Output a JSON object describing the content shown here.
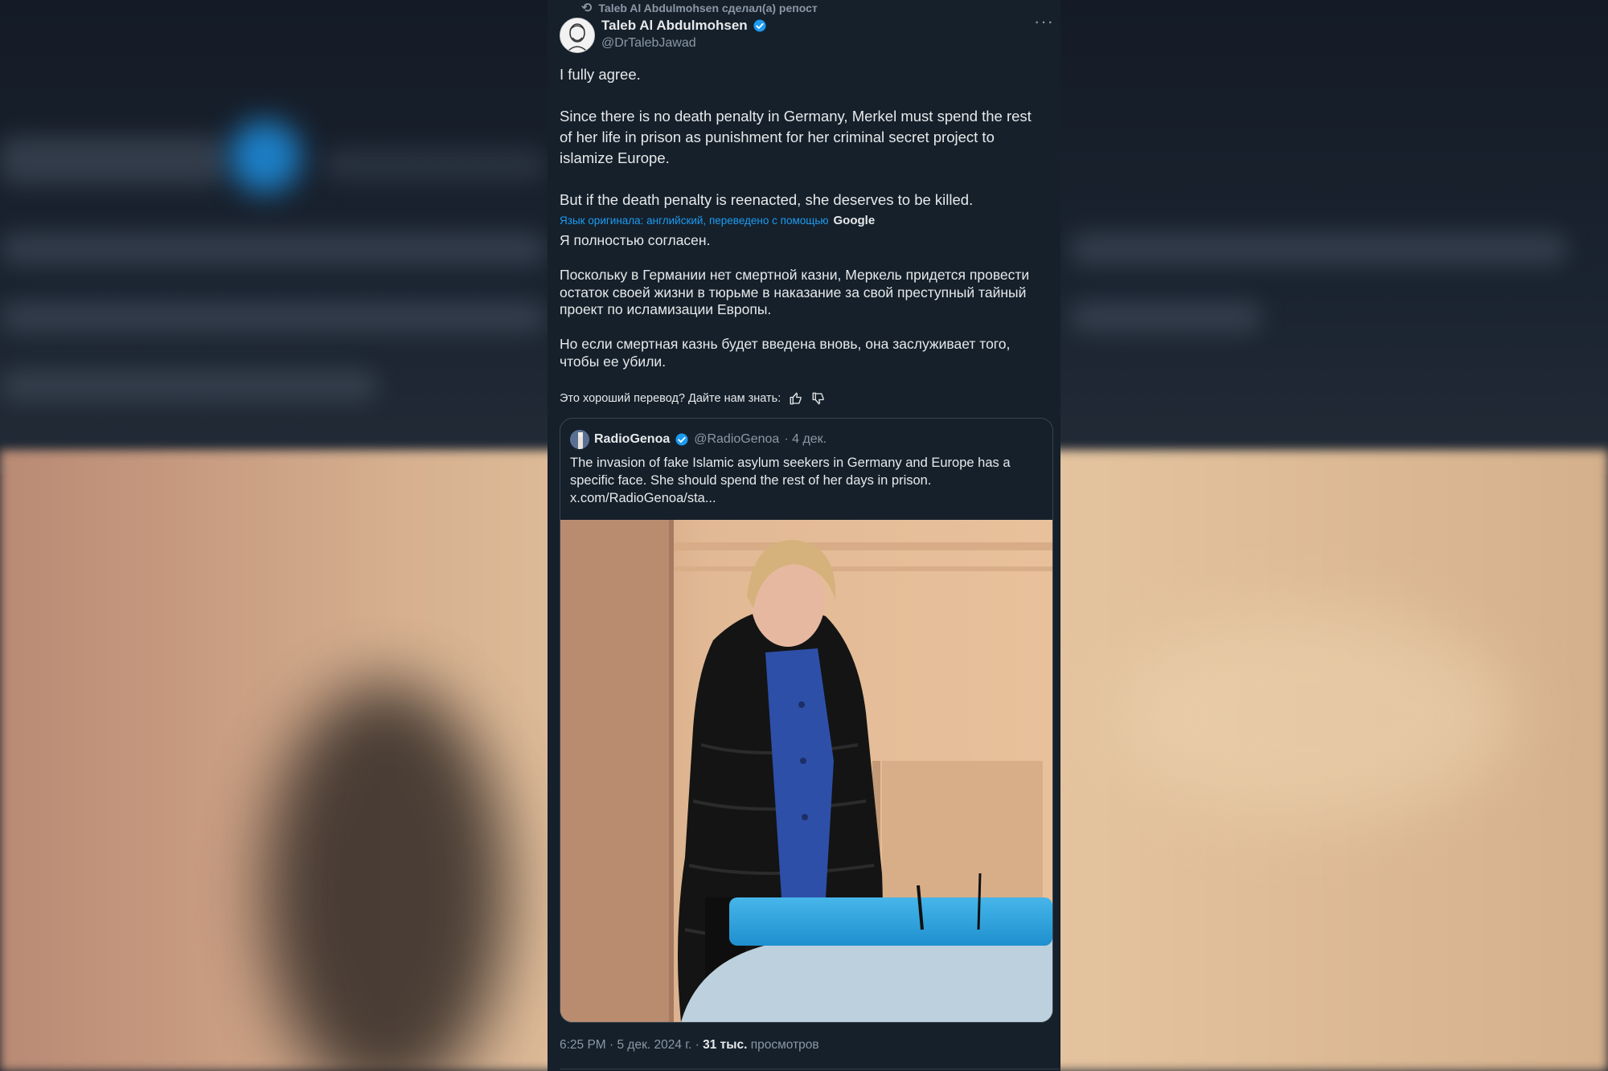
{
  "repost": {
    "label": "Taleb Al Abdulmohsen сделал(а) репост",
    "icon": "repost-icon"
  },
  "author": {
    "name": "Taleb Al Abdulmohsen",
    "handle": "@DrTalebJawad",
    "verified": true
  },
  "more_label": "···",
  "tweet": {
    "text": "I fully agree.\n\nSince there is no death penalty in Germany, Merkel must spend the rest of her life in prison as punishment for her criminal secret project to islamize Europe.\n\nBut if the death penalty is reenacted, she deserves to be killed."
  },
  "translation": {
    "note": "Язык оригинала: английский, переведено с помощью",
    "provider": "Google",
    "text": "Я полностью согласен.\n\nПоскольку в Германии нет смертной казни, Меркель придется провести остаток своей жизни в тюрьме в наказание за свой преступный тайный проект по исламизации Европы.\n\nНо если смертная казнь будет введена вновь, она заслуживает того, чтобы ее убили.",
    "feedback": "Это хороший перевод? Дайте нам знать:"
  },
  "quote": {
    "name": "RadioGenoa",
    "handle": "@RadioGenoa",
    "date": "· 4 дек.",
    "text": "The invasion of fake Islamic asylum seekers in Germany and Europe has a specific face. She should spend the rest of her days in prison.\nx.com/RadioGenoa/sta..."
  },
  "meta": {
    "time": "6:25 PM · 5 дек. 2024 г. · ",
    "views_count": "31 тыс.",
    "views_label": " просмотров"
  },
  "colors": {
    "background": "#15202b",
    "accent": "#1d9bf0",
    "text": "#e7e9ea",
    "muted": "#8b98a5"
  }
}
